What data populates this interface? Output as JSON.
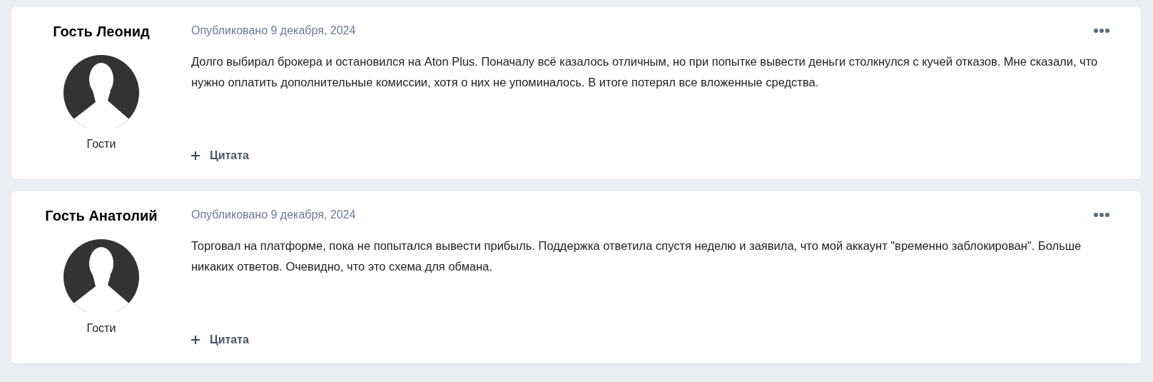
{
  "posts": [
    {
      "author": "Гость Леонид",
      "group": "Гости",
      "date": "Опубликовано 9 декабря, 2024",
      "text": "Долго выбирал брокера и остановился на Aton Plus. Поначалу всё казалось отличным, но при попытке вывести деньги столкнулся с кучей отказов. Мне сказали, что нужно оплатить дополнительные комиссии, хотя о них не упоминалось. В итоге потерял все вложенные средства.",
      "quote_label": "Цитата"
    },
    {
      "author": "Гость Анатолий",
      "group": "Гости",
      "date": "Опубликовано 9 декабря, 2024",
      "text": "Торговал на платформе, пока не попытался вывести прибыль. Поддержка ответила спустя неделю и заявила, что мой аккаунт \"временно заблокирован\". Больше никаких ответов. Очевидно, что это схема для обмана.",
      "quote_label": "Цитата"
    }
  ]
}
